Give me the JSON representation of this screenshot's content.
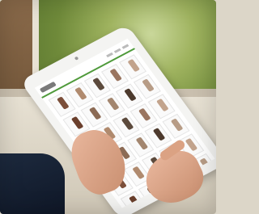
{
  "scene": {
    "colors": {
      "garden": "#8aa44a",
      "table": "#ddd6c7",
      "tablet": "#f4f4f2",
      "screen_accent": "#4f9a3b",
      "skin": "#d9a284",
      "sleeve": "#1a2436"
    },
    "icons": [
      "tablet-device",
      "hand-left",
      "hand-right",
      "product-thumbnail"
    ],
    "thumbnail_colors": [
      "#7c4f3a",
      "#b08a6e",
      "#5c4a3c",
      "#9a7560",
      "#c2a38c",
      "#6a3f2c",
      "#8c6b55",
      "#a3866f",
      "#4d3a2d",
      "#b79c86"
    ]
  }
}
